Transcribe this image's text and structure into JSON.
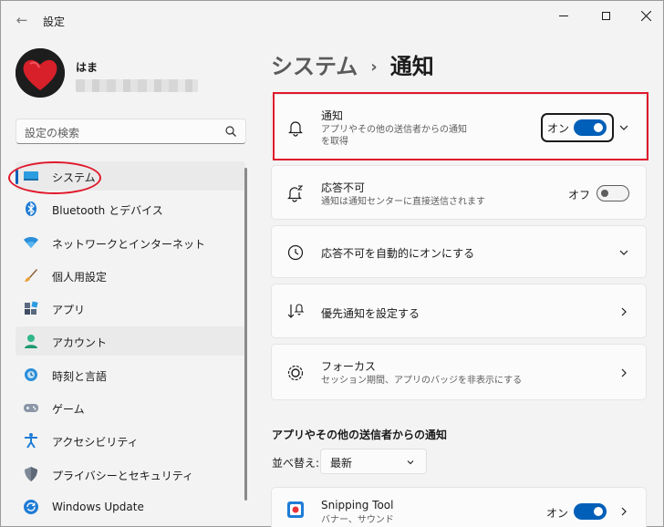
{
  "window": {
    "title": "設定",
    "back_icon": "arrow-left-icon",
    "controls": [
      "minimize-icon",
      "maximize-icon",
      "close-icon"
    ]
  },
  "user": {
    "name": "はま"
  },
  "search": {
    "placeholder": "設定の検索"
  },
  "nav": {
    "items": [
      {
        "label": "システム",
        "icon": "monitor-icon",
        "selected": true
      },
      {
        "label": "Bluetooth とデバイス",
        "icon": "bluetooth-icon"
      },
      {
        "label": "ネットワークとインターネット",
        "icon": "wifi-icon"
      },
      {
        "label": "個人用設定",
        "icon": "brush-icon"
      },
      {
        "label": "アプリ",
        "icon": "apps-icon"
      },
      {
        "label": "アカウント",
        "icon": "person-icon"
      },
      {
        "label": "時刻と言語",
        "icon": "globe-clock-icon"
      },
      {
        "label": "ゲーム",
        "icon": "gamepad-icon"
      },
      {
        "label": "アクセシビリティ",
        "icon": "accessibility-icon"
      },
      {
        "label": "プライバシーとセキュリティ",
        "icon": "shield-icon"
      },
      {
        "label": "Windows Update",
        "icon": "update-icon"
      }
    ]
  },
  "breadcrumb": {
    "parent": "システム",
    "separator": "›",
    "current": "通知"
  },
  "cards": {
    "notifications": {
      "title": "通知",
      "desc_line1": "アプリやその他の送信者からの通知",
      "desc_line2": "を取得",
      "toggle_label": "オン",
      "toggle_on": true
    },
    "dnd": {
      "title": "応答不可",
      "desc": "通知は通知センターに直接送信されます",
      "toggle_label": "オフ",
      "toggle_on": false
    },
    "dnd_auto": {
      "title": "応答不可を自動的にオンにする"
    },
    "priority": {
      "title": "優先通知を設定する"
    },
    "focus": {
      "title": "フォーカス",
      "desc": "セッション期間、アプリのバッジを非表示にする"
    },
    "snipping": {
      "title": "Snipping Tool",
      "desc": "バナー、サウンド",
      "toggle_label": "オン",
      "toggle_on": true
    }
  },
  "apps_section": {
    "header": "アプリやその他の送信者からの通知",
    "sort_label": "並べ替え:",
    "sort_value": "最新"
  },
  "accent_color": "#005fb8",
  "annotation_color": "#e0192b"
}
